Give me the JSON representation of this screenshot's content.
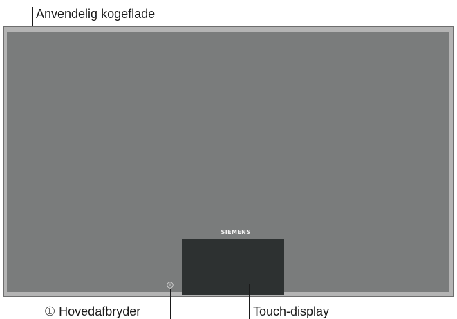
{
  "labels": {
    "cooking_surface": "Anvendelig kogeflade",
    "main_switch": "Hovedafbryder",
    "main_switch_symbol": "①",
    "touch_display": "Touch-display"
  },
  "hob": {
    "brand": "SIEMENS",
    "colors": {
      "glass": "#7a7c7c",
      "frame": "#b4b4b4",
      "display": "#2d3131",
      "leader_lines": "#1a1a1a"
    }
  },
  "icons": {
    "power": "power-switch-icon"
  }
}
